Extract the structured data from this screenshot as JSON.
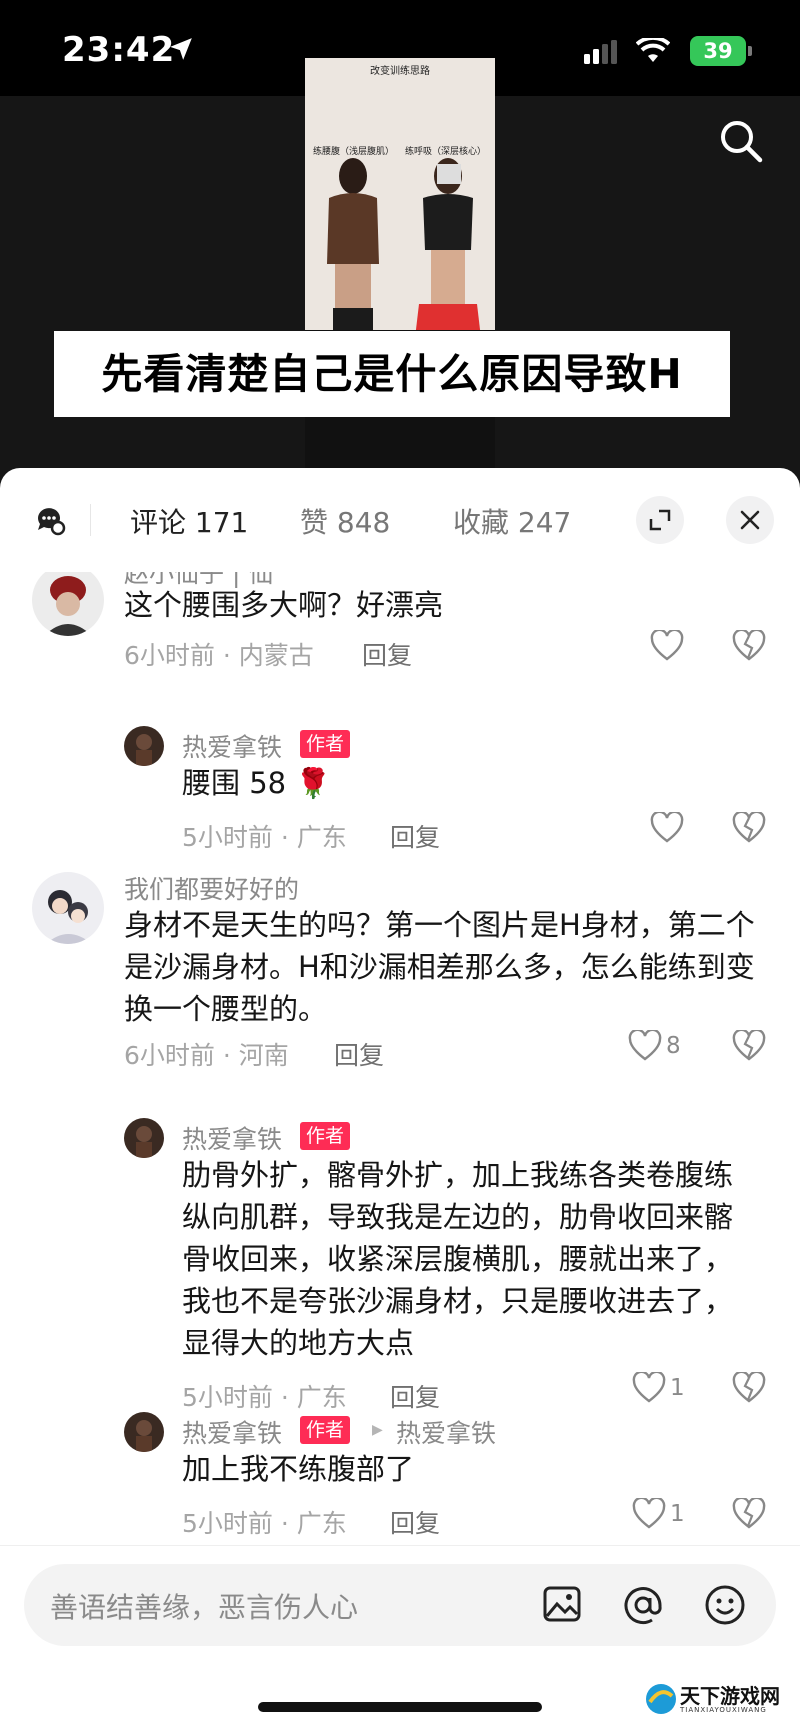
{
  "status_bar": {
    "time": "23:42",
    "battery": "39"
  },
  "video": {
    "thumbnail_title": "改变训练思路",
    "thumbnail_labels": [
      "练腰腹（浅层腹肌）",
      "练呼吸（深层核心）"
    ],
    "caption": "先看清楚自己是什么原因导致H"
  },
  "tabs": [
    {
      "label": "评论 171",
      "active": true
    },
    {
      "label": "赞 848",
      "active": false
    },
    {
      "label": "收藏 247",
      "active": false
    }
  ],
  "comments": [
    {
      "id": "c1",
      "username": "赵小仙子 | 仙",
      "text": "这个腰围多大啊？好漂亮",
      "time_location": "6小时前 · 内蒙古",
      "reply_label": "回复",
      "likes": ""
    },
    {
      "id": "r1",
      "username": "热爱拿铁",
      "badge": "作者",
      "text": "腰围 58",
      "emoji": "🌹",
      "time_location": "5小时前 · 广东",
      "reply_label": "回复",
      "likes": ""
    },
    {
      "id": "c2",
      "username": "我们都要好好的",
      "text": "身材不是天生的吗？第一个图片是H身材，第二个是沙漏身材。H和沙漏相差那么多，怎么能练到变换一个腰型的。",
      "time_location": "6小时前 · 河南",
      "reply_label": "回复",
      "likes": "8"
    },
    {
      "id": "r2",
      "username": "热爱拿铁",
      "badge": "作者",
      "text": "肋骨外扩，髂骨外扩，加上我练各类卷腹练纵向肌群，导致我是左边的，肋骨收回来髂骨收回来，收紧深层腹横肌，腰就出来了，我也不是夸张沙漏身材，只是腰收进去了，显得大的地方大点",
      "time_location": "5小时前 · 广东",
      "reply_label": "回复",
      "likes": "1"
    },
    {
      "id": "r3",
      "username": "热爱拿铁",
      "badge": "作者",
      "reply_to": "热爱拿铁",
      "text": "加上我不练腹部了",
      "time_location": "5小时前 · 广东",
      "reply_label": "回复",
      "likes": "1"
    }
  ],
  "input": {
    "placeholder": "善语结善缘，恶言伤人心"
  },
  "watermark": {
    "text": "天下游戏网",
    "sub": "TIANXIAYOUXIWANG"
  },
  "colors": {
    "accent": "#fe2c55",
    "battery": "#35c759"
  },
  "icons": [
    "location-arrow-icon",
    "cellular-signal-icon",
    "wifi-icon",
    "search-icon",
    "chat-settings-icon",
    "expand-icon",
    "close-icon",
    "heart-icon",
    "broken-heart-icon",
    "image-icon",
    "at-icon",
    "emoji-icon"
  ]
}
